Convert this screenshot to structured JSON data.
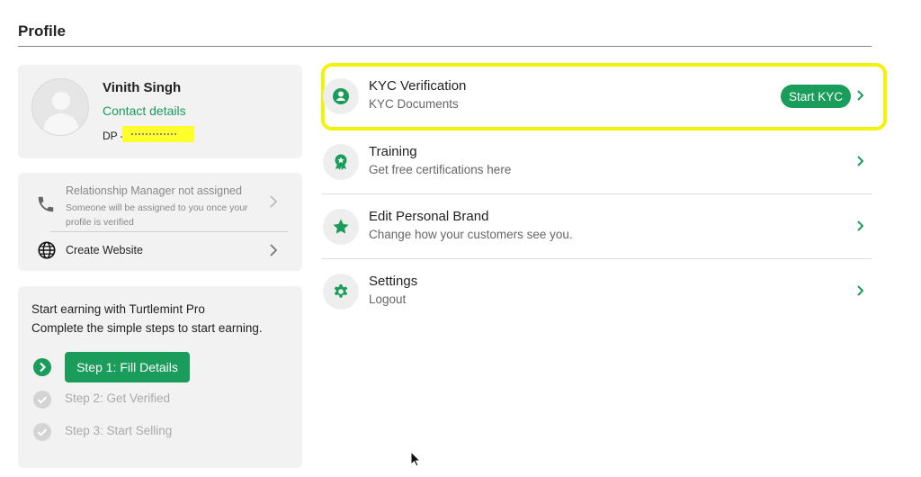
{
  "page": {
    "title": "Profile"
  },
  "profile": {
    "name": "Vinith Singh",
    "contact_link": "Contact details",
    "dp_label": "DP -"
  },
  "relationship_manager": {
    "title": "Relationship Manager not assigned",
    "subtitle": "Someone will be assigned to you once your profile is verified"
  },
  "website": {
    "label": "Create Website"
  },
  "earning": {
    "line1": "Start earning with Turtlemint Pro",
    "line2": "Complete the simple steps to start earning.",
    "steps": [
      {
        "label": "Step 1: Fill Details",
        "state": "active"
      },
      {
        "label": "Step 2: Get Verified",
        "state": "pending"
      },
      {
        "label": "Step 3: Start Selling",
        "state": "pending"
      }
    ]
  },
  "menu": [
    {
      "title": "KYC Verification",
      "subtitle": "KYC Documents",
      "icon": "user-circle-icon",
      "action": "Start KYC"
    },
    {
      "title": "Training",
      "subtitle": "Get free certifications here",
      "icon": "badge-icon"
    },
    {
      "title": "Edit Personal Brand",
      "subtitle": "Change how your customers see you.",
      "icon": "star-icon"
    },
    {
      "title": "Settings",
      "subtitle": "Logout",
      "icon": "gear-icon"
    }
  ],
  "colors": {
    "accent": "#1a9c5a",
    "highlight": "#f2f20a",
    "card_bg": "#f2f2f2"
  }
}
